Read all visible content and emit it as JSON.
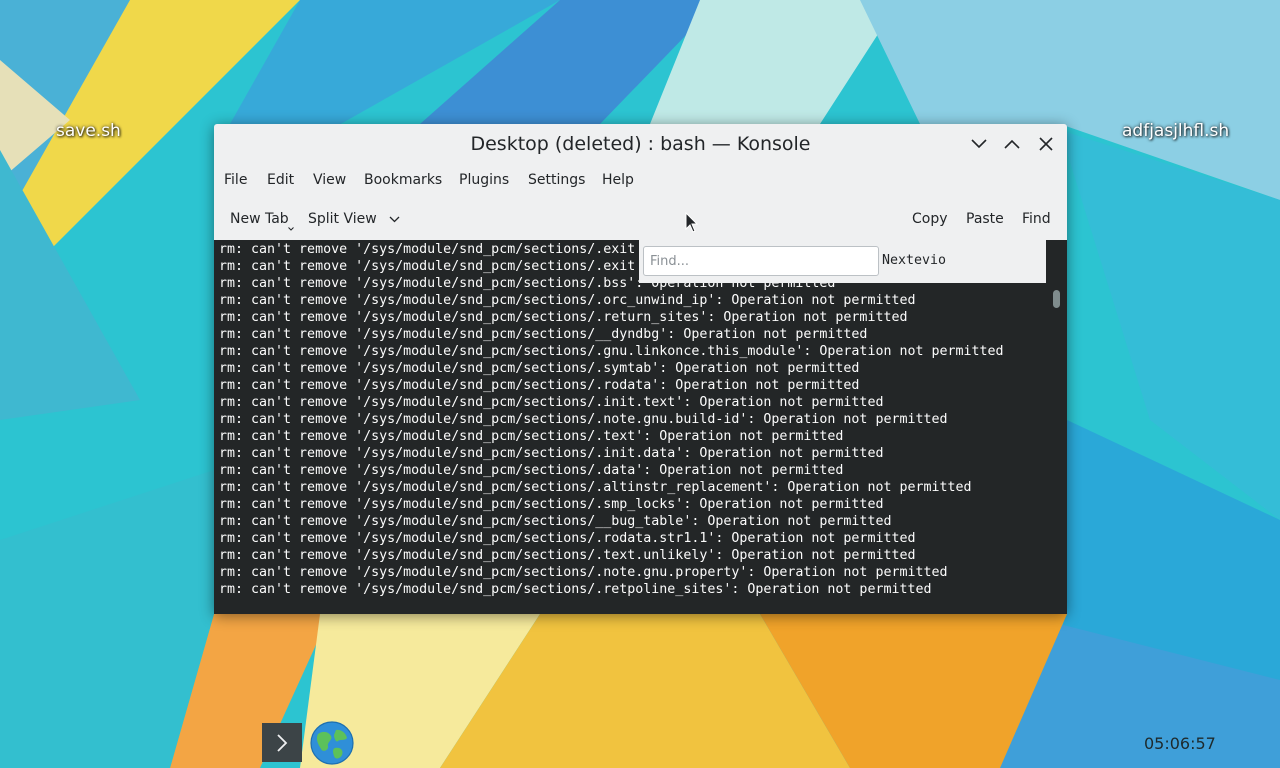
{
  "desktop": {
    "icons": [
      {
        "label": "save.sh"
      },
      {
        "label": "adfjasjlhfl.sh"
      }
    ]
  },
  "window": {
    "title": "Desktop (deleted) : bash — Konsole",
    "controls": {
      "minimize": "chevron-down-icon",
      "maximize": "chevron-up-icon",
      "close": "close-icon"
    }
  },
  "menubar": {
    "items": [
      "File",
      "Edit",
      "View",
      "Bookmarks",
      "Plugins",
      "Settings",
      "Help"
    ]
  },
  "toolbar": {
    "new_tab": "New Tab",
    "split_view": "Split View",
    "copy": "Copy",
    "paste": "Paste",
    "find": "Find"
  },
  "find_bar": {
    "placeholder": "Find...",
    "trailing_text": "Nextevio"
  },
  "terminal": {
    "lines": [
      "rm: can't remove '/sys/module/snd_pcm/sections/.exit",
      "rm: can't remove '/sys/module/snd_pcm/sections/.exit",
      "rm: can't remove '/sys/module/snd_pcm/sections/.bss': Operation not permitted",
      "rm: can't remove '/sys/module/snd_pcm/sections/.orc_unwind_ip': Operation not permitted",
      "rm: can't remove '/sys/module/snd_pcm/sections/.return_sites': Operation not permitted",
      "rm: can't remove '/sys/module/snd_pcm/sections/__dyndbg': Operation not permitted",
      "rm: can't remove '/sys/module/snd_pcm/sections/.gnu.linkonce.this_module': Operation not permitted",
      "rm: can't remove '/sys/module/snd_pcm/sections/.symtab': Operation not permitted",
      "rm: can't remove '/sys/module/snd_pcm/sections/.rodata': Operation not permitted",
      "rm: can't remove '/sys/module/snd_pcm/sections/.init.text': Operation not permitted",
      "rm: can't remove '/sys/module/snd_pcm/sections/.note.gnu.build-id': Operation not permitted",
      "rm: can't remove '/sys/module/snd_pcm/sections/.text': Operation not permitted",
      "rm: can't remove '/sys/module/snd_pcm/sections/.init.data': Operation not permitted",
      "rm: can't remove '/sys/module/snd_pcm/sections/.data': Operation not permitted",
      "rm: can't remove '/sys/module/snd_pcm/sections/.altinstr_replacement': Operation not permitted",
      "rm: can't remove '/sys/module/snd_pcm/sections/.smp_locks': Operation not permitted",
      "rm: can't remove '/sys/module/snd_pcm/sections/__bug_table': Operation not permitted",
      "rm: can't remove '/sys/module/snd_pcm/sections/.rodata.str1.1': Operation not permitted",
      "rm: can't remove '/sys/module/snd_pcm/sections/.text.unlikely': Operation not permitted",
      "rm: can't remove '/sys/module/snd_pcm/sections/.note.gnu.property': Operation not permitted",
      "rm: can't remove '/sys/module/snd_pcm/sections/.retpoline_sites': Operation not permitted"
    ]
  },
  "panel": {
    "clock": "05:06:57",
    "launcher_icon": "chevron-right-icon",
    "browser_icon": "globe-icon"
  },
  "colors": {
    "terminal_bg": "#232627",
    "terminal_fg": "#fcfcfc",
    "window_bg": "#eff0f1",
    "panel_button": "#3c4447"
  }
}
